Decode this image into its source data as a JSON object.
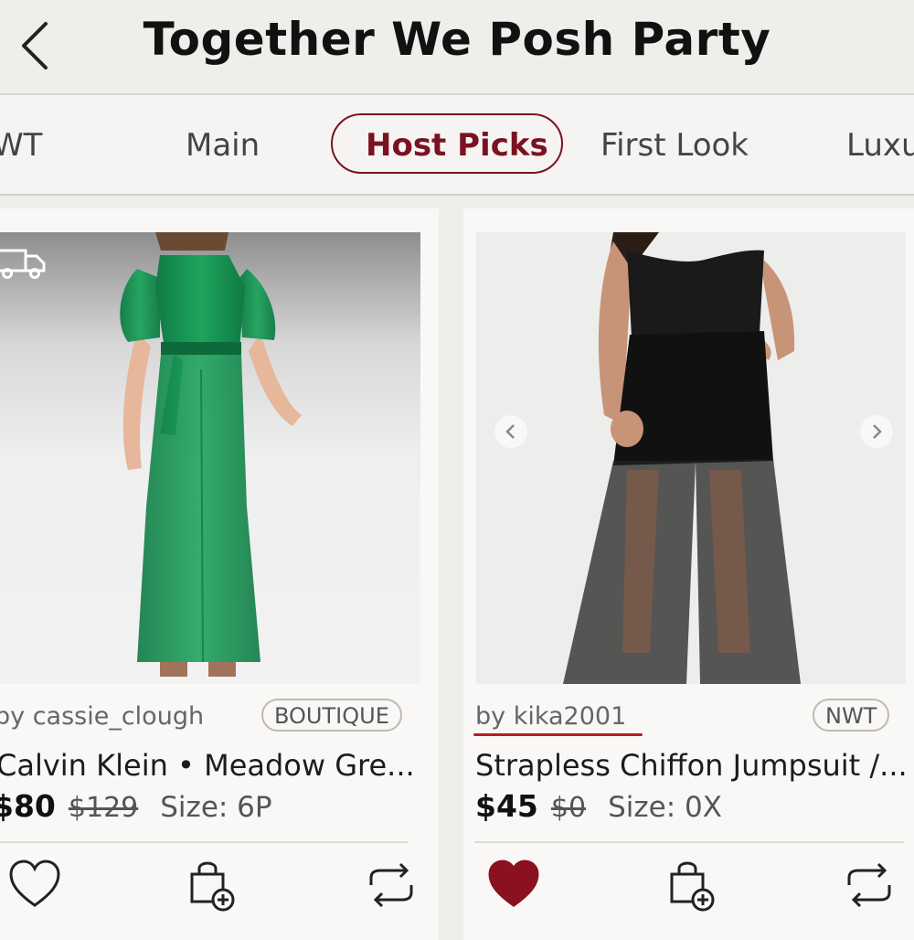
{
  "header": {
    "title": "Together We Posh Party"
  },
  "tabs": [
    {
      "label": "WT"
    },
    {
      "label": "Main"
    },
    {
      "label": "Host Picks"
    },
    {
      "label": "First Look"
    },
    {
      "label": "Luxu"
    }
  ],
  "listings": [
    {
      "seller": "by cassie_clough",
      "badge": "BOUTIQUE",
      "title": "Calvin Klein • Meadow Gre...",
      "price": "$80",
      "original_price": "$129",
      "size": "Size: 6P",
      "liked": false
    },
    {
      "seller": "by kika2001",
      "badge": "NWT",
      "title": "Strapless Chiffon Jumpsuit /...",
      "price": "$45",
      "original_price": "$0",
      "size": "Size: 0X",
      "liked": true
    }
  ],
  "colors": {
    "accent": "#7a1222",
    "heart_filled": "#8b1020",
    "background": "#efeeeb"
  },
  "icons": [
    "back-chevron-icon",
    "shipping-truck-icon",
    "heart-icon",
    "bag-add-icon",
    "share-repeat-icon",
    "carousel-left-icon",
    "carousel-right-icon"
  ]
}
